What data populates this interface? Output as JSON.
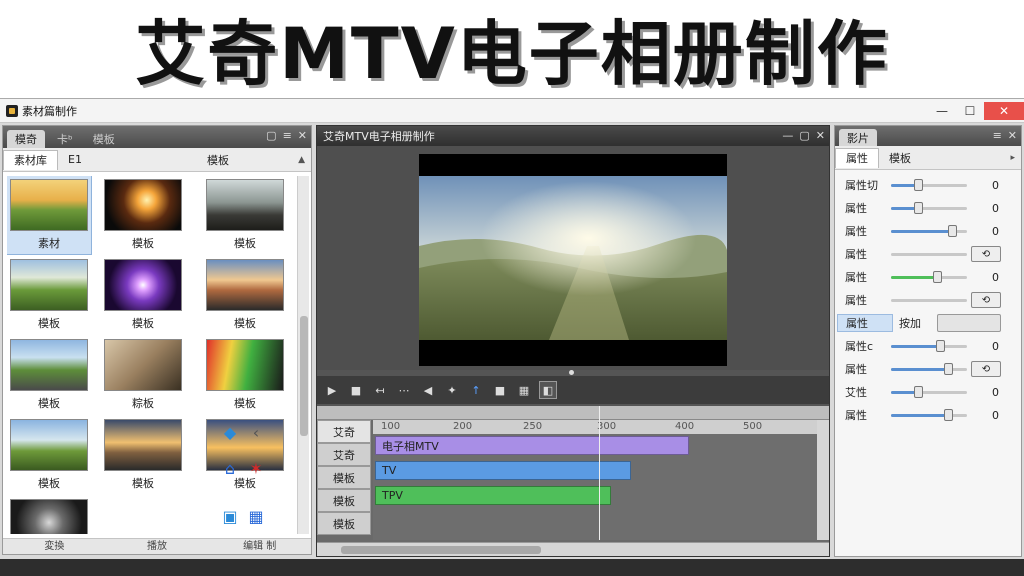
{
  "banner": {
    "title": "艾奇MTV电子相册制作"
  },
  "window": {
    "title": "素材篇制作",
    "controls": {
      "minimize": "—",
      "maximize": "☐",
      "close": "✕"
    }
  },
  "left_panel": {
    "tabs": [
      "模奇",
      "卡ᵇ",
      "模板"
    ],
    "sub_tabs": [
      "素材库",
      "E1"
    ],
    "section_title": "模板",
    "items": [
      {
        "label": "素材",
        "theme": "meadow-sunset"
      },
      {
        "label": "模板",
        "theme": "hands-burst"
      },
      {
        "label": "模板",
        "theme": "motorcycle-road"
      },
      {
        "label": "模板",
        "theme": "green-hills"
      },
      {
        "label": "模板",
        "theme": "purple-burst"
      },
      {
        "label": "模板",
        "theme": "rider-sunset"
      },
      {
        "label": "模板",
        "theme": "cyclist-path"
      },
      {
        "label": "粽板",
        "theme": "sepia-dancer"
      },
      {
        "label": "模板",
        "theme": "red-green-light"
      },
      {
        "label": "模板",
        "theme": "hill-walker"
      },
      {
        "label": "模板",
        "theme": "sunset-silhouette"
      },
      {
        "label": "模板",
        "theme": "horizon-sunset"
      },
      {
        "label": "",
        "theme": "dark-tube"
      }
    ],
    "side_icons": [
      {
        "name": "arrow-diamond-icon",
        "glyph": "◆"
      },
      {
        "name": "small-glyph-icon",
        "glyph": "‹"
      },
      {
        "name": "image-edit-icon",
        "glyph": "⌂"
      },
      {
        "name": "red-glyph-icon",
        "glyph": "✶"
      },
      {
        "name": "folder-icon",
        "glyph": "▣"
      },
      {
        "name": "grid-icon",
        "glyph": "▦"
      }
    ],
    "footer": [
      "変換",
      "播放",
      "编辑 制"
    ]
  },
  "center_panel": {
    "title": "艾奇MTV电子相册制作",
    "controls": [
      "▶",
      "■",
      "↤",
      "⋯",
      "◀",
      "✦",
      "↑",
      "■",
      "▦",
      "◧"
    ],
    "ruler_ticks": [
      "100",
      "200",
      "250",
      "300",
      "400",
      "500"
    ],
    "tracks": [
      "艾奇",
      "艾奇",
      "模板",
      "模板",
      "模板"
    ],
    "clips": [
      {
        "label": "电子相MTV",
        "color": "#a88ee6"
      },
      {
        "label": "TV",
        "color": "#5b9be3"
      },
      {
        "label": "TPV",
        "color": "#4fbf5a"
      }
    ]
  },
  "right_panel": {
    "tabs": [
      "影片",
      "属性",
      "模板"
    ],
    "properties": [
      {
        "label": "属性切",
        "value": "0",
        "level": 0.35
      },
      {
        "label": "属性",
        "value": "0",
        "level": 0.35
      },
      {
        "label": "属性",
        "value": "0",
        "level": 0.8
      },
      {
        "label": "属性",
        "button": "⟲"
      },
      {
        "label": "属性",
        "value": "0",
        "level": 0.6,
        "accent": "#4fbf5a"
      },
      {
        "label": "属性",
        "button": "⟲"
      },
      {
        "label": "属性",
        "mid_text": "按加",
        "wide": true
      },
      {
        "label": "属性c",
        "value": "0",
        "level": 0.65
      },
      {
        "label": "属性",
        "button": "⟲",
        "level": 0.75
      },
      {
        "label": "艾性",
        "value": "0",
        "level": 0.35
      },
      {
        "label": "属性",
        "value": "0",
        "level": 0.75
      }
    ]
  }
}
